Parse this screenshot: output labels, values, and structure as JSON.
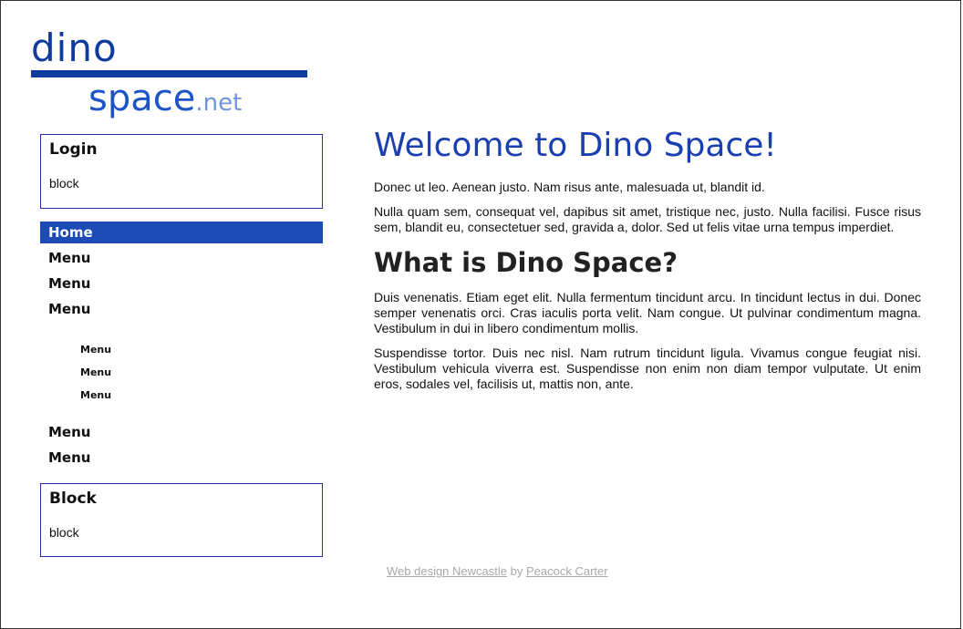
{
  "logo": {
    "line1": "dino",
    "line2": "space",
    "suffix": ".net"
  },
  "login_block": {
    "title": "Login",
    "body": "block"
  },
  "menu": {
    "items_top": [
      "Home",
      "Menu",
      "Menu",
      "Menu"
    ],
    "submenu": [
      "Menu",
      "Menu",
      "Menu"
    ],
    "items_bottom": [
      "Menu",
      "Menu"
    ]
  },
  "bottom_block": {
    "title": "Block",
    "body": "block"
  },
  "main": {
    "title": "Welcome to Dino Space!",
    "para1": "Donec ut leo. Aenean justo. Nam risus ante, malesuada ut, blandit id.",
    "para2": "Nulla quam sem, consequat vel, dapibus sit amet, tristique nec, justo. Nulla facilisi. Fusce risus sem, blandit eu, consectetuer sed, gravida a, dolor. Sed ut felis vitae urna tempus imperdiet.",
    "subtitle": "What is Dino Space?",
    "para3": "Duis venenatis. Etiam eget elit. Nulla fermentum tincidunt arcu. In tincidunt lectus in dui. Donec semper venenatis orci. Cras iaculis porta velit. Nam congue. Ut pulvinar condimentum magna. Vestibulum in dui in libero condimentum mollis.",
    "para4": "Suspendisse tortor. Duis nec nisl. Nam rutrum tincidunt ligula. Vivamus congue feugiat nisi. Vestibulum vehicula viverra est. Suspendisse non enim non diam tempor vulputate. Ut enim eros, sodales vel, facilisis ut, mattis non, ante."
  },
  "footer": {
    "link1": "Web design Newcastle",
    "by": "by",
    "link2": "Peacock Carter"
  },
  "colors": {
    "brand_blue": "#1d4bb5",
    "heading_blue": "#1a3fb0",
    "block_border": "#2a2ab8"
  }
}
